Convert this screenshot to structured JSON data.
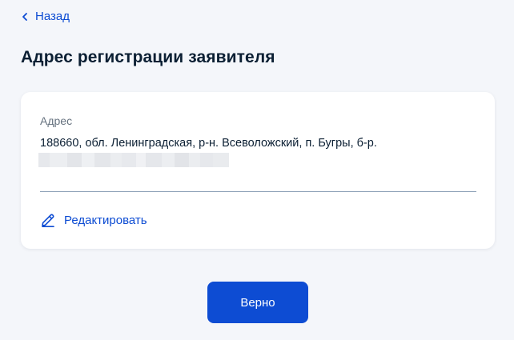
{
  "nav": {
    "back_label": "Назад",
    "back_icon": "chevron-left-icon"
  },
  "header": {
    "title": "Адрес регистрации заявителя"
  },
  "card": {
    "field_label": "Адрес",
    "address_value": "188660, обл. Ленинградская, р-н. Всеволожский, п. Бугры, б-р.",
    "edit_label": "Редактировать",
    "edit_icon": "pencil-icon"
  },
  "actions": {
    "confirm_label": "Верно"
  },
  "colors": {
    "accent": "#0d4cd3",
    "background": "#f4f6fa",
    "text": "#0b1f33",
    "muted": "#66727f"
  }
}
